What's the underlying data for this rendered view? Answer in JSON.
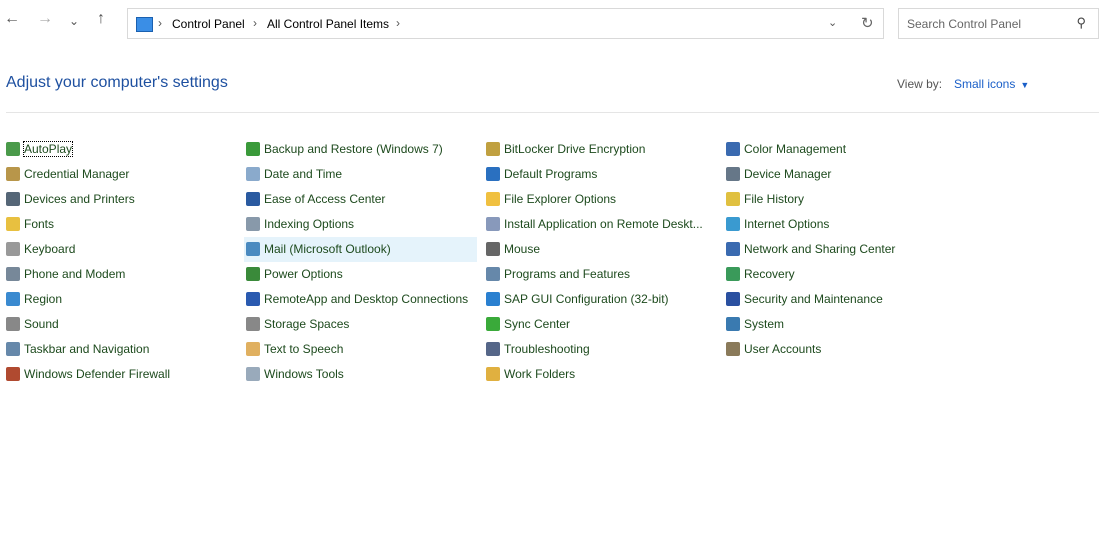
{
  "nav": {
    "back": "←",
    "forward": "→",
    "recent": "⌄",
    "up": "↑"
  },
  "breadcrumb": [
    "Control Panel",
    "All Control Panel Items"
  ],
  "search": {
    "placeholder": "Search Control Panel"
  },
  "header": {
    "title": "Adjust your computer's settings",
    "view_by_label": "View by:",
    "view_by_value": "Small icons"
  },
  "columns": [
    [
      {
        "label": "AutoPlay",
        "color": "#4a9a4a"
      },
      {
        "label": "Credential Manager",
        "color": "#b8964a"
      },
      {
        "label": "Devices and Printers",
        "color": "#556677"
      },
      {
        "label": "Fonts",
        "color": "#e8c040"
      },
      {
        "label": "Keyboard",
        "color": "#999999"
      },
      {
        "label": "Phone and Modem",
        "color": "#778899"
      },
      {
        "label": "Region",
        "color": "#3a8ad0"
      },
      {
        "label": "Sound",
        "color": "#888888"
      },
      {
        "label": "Taskbar and Navigation",
        "color": "#6688aa"
      },
      {
        "label": "Windows Defender Firewall",
        "color": "#b04a30"
      }
    ],
    [
      {
        "label": "Backup and Restore (Windows 7)",
        "color": "#3a9a3a"
      },
      {
        "label": "Date and Time",
        "color": "#8aaacc"
      },
      {
        "label": "Ease of Access Center",
        "color": "#2a5aa0"
      },
      {
        "label": "Indexing Options",
        "color": "#8899aa"
      },
      {
        "label": "Mail (Microsoft Outlook)",
        "color": "#4a8ac0"
      },
      {
        "label": "Power Options",
        "color": "#3a8a3a"
      },
      {
        "label": "RemoteApp and Desktop Connections",
        "color": "#2a5ab0"
      },
      {
        "label": "Storage Spaces",
        "color": "#888888"
      },
      {
        "label": "Text to Speech",
        "color": "#e0b060"
      },
      {
        "label": "Windows Tools",
        "color": "#99aabb"
      }
    ],
    [
      {
        "label": "BitLocker Drive Encryption",
        "color": "#c0a040"
      },
      {
        "label": "Default Programs",
        "color": "#2a70c0"
      },
      {
        "label": "File Explorer Options",
        "color": "#f0c040"
      },
      {
        "label": "Install Application on Remote Deskt...",
        "color": "#8899bb"
      },
      {
        "label": "Mouse",
        "color": "#666666"
      },
      {
        "label": "Programs and Features",
        "color": "#6688aa"
      },
      {
        "label": "SAP GUI Configuration (32-bit)",
        "color": "#2a80d0"
      },
      {
        "label": "Sync Center",
        "color": "#3aaa3a"
      },
      {
        "label": "Troubleshooting",
        "color": "#556688"
      },
      {
        "label": "Work Folders",
        "color": "#e0b040"
      }
    ],
    [
      {
        "label": "Color Management",
        "color": "#3a6ab0"
      },
      {
        "label": "Device Manager",
        "color": "#667788"
      },
      {
        "label": "File History",
        "color": "#e0c040"
      },
      {
        "label": "Internet Options",
        "color": "#3a9ad0"
      },
      {
        "label": "Network and Sharing Center",
        "color": "#3a6ab0"
      },
      {
        "label": "Recovery",
        "color": "#3a9a5a"
      },
      {
        "label": "Security and Maintenance",
        "color": "#2a50a0"
      },
      {
        "label": "System",
        "color": "#3a7ab0"
      },
      {
        "label": "User Accounts",
        "color": "#8a7a5a"
      }
    ]
  ]
}
